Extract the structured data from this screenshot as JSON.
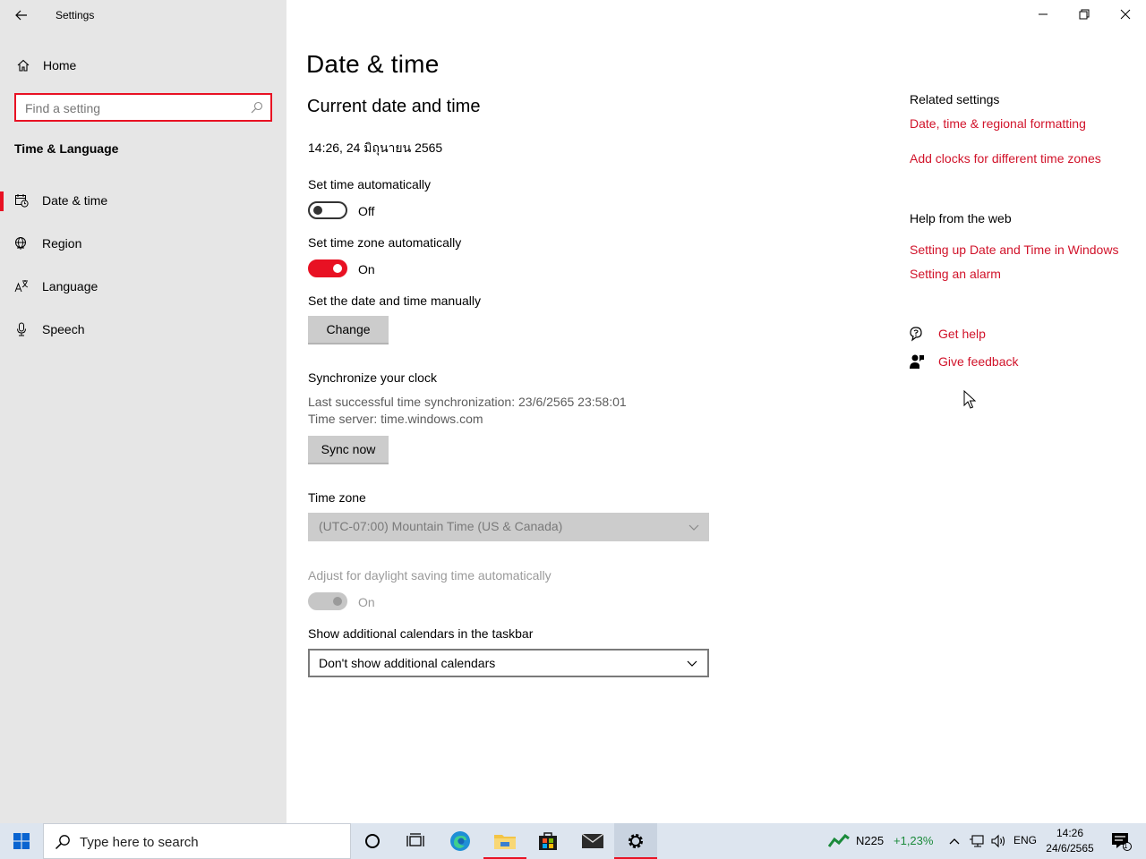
{
  "window": {
    "title": "Settings",
    "controls": [
      "minimize-icon",
      "restore-icon",
      "close-icon"
    ]
  },
  "sidebar": {
    "home_label": "Home",
    "search_placeholder": "Find a setting",
    "section": "Time & Language",
    "items": [
      {
        "label": "Date & time",
        "icon": "calendar-clock-icon",
        "active": true
      },
      {
        "label": "Region",
        "icon": "globe-icon",
        "active": false
      },
      {
        "label": "Language",
        "icon": "language-icon",
        "active": false
      },
      {
        "label": "Speech",
        "icon": "microphone-icon",
        "active": false
      }
    ]
  },
  "main": {
    "title": "Date & time",
    "subtitle": "Current date and time",
    "current_datetime": "14:26, 24 มิถุนายน 2565",
    "set_time_auto": {
      "label": "Set time automatically",
      "state": "Off"
    },
    "set_tz_auto": {
      "label": "Set time zone automatically",
      "state": "On"
    },
    "manual": {
      "label": "Set the date and time manually",
      "button": "Change"
    },
    "sync": {
      "label": "Synchronize your clock",
      "last_sync": "Last successful time synchronization: 23/6/2565 23:58:01",
      "server": "Time server: time.windows.com",
      "button": "Sync now"
    },
    "timezone": {
      "label": "Time zone",
      "value": "(UTC-07:00) Mountain Time (US & Canada)"
    },
    "dst": {
      "label": "Adjust for daylight saving time automatically",
      "state": "On"
    },
    "calendars": {
      "label": "Show additional calendars in the taskbar",
      "value": "Don't show additional calendars"
    }
  },
  "related": {
    "heading": "Related settings",
    "links": [
      "Date, time & regional formatting",
      "Add clocks for different time zones"
    ],
    "help_heading": "Help from the web",
    "help_links": [
      "Setting up Date and Time in Windows",
      "Setting an alarm"
    ],
    "get_help": "Get help",
    "give_feedback": "Give feedback"
  },
  "taskbar": {
    "search_placeholder": "Type here to search",
    "stock_name": "N225",
    "stock_change": "+1,23%",
    "stock_color": "#1a8a3a",
    "lang": "ENG",
    "time": "14:26",
    "date": "24/6/2565",
    "notification_count": "1"
  },
  "colors": {
    "accent": "#e81123",
    "link": "#d1132a",
    "sidebar_bg": "#e6e6e6",
    "taskbar_bg": "#dde5ef"
  }
}
